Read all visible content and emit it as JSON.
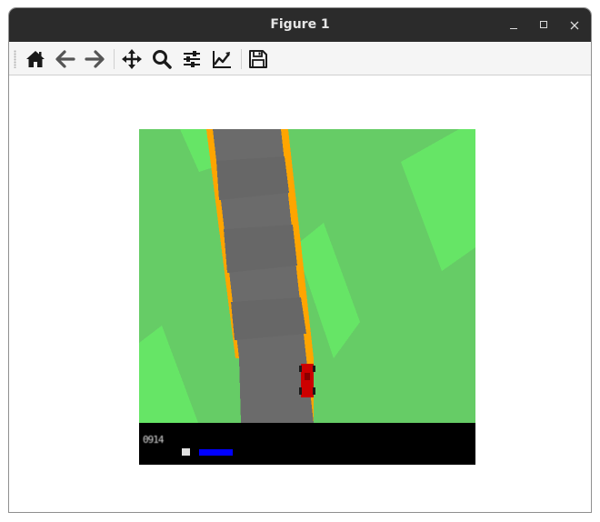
{
  "window": {
    "title": "Figure 1"
  },
  "toolbar": {
    "tools": [
      {
        "name": "home",
        "icon": "home-icon"
      },
      {
        "name": "back",
        "icon": "arrow-left-icon"
      },
      {
        "name": "forward",
        "icon": "arrow-right-icon"
      },
      {
        "name": "pan",
        "icon": "move-icon"
      },
      {
        "name": "zoom",
        "icon": "magnifier-icon"
      },
      {
        "name": "configure-subplots",
        "icon": "sliders-icon"
      },
      {
        "name": "edit-axes",
        "icon": "line-chart-icon"
      },
      {
        "name": "save",
        "icon": "floppy-disk-icon"
      }
    ]
  },
  "game": {
    "score_text": "0914",
    "colors": {
      "grass": "#66cc66",
      "grass_light": "#66e566",
      "road": "#6b6b6b",
      "road_edge": "#ffa500",
      "car": "#cc0000",
      "hud": "#000000",
      "speed_bar": "#0000ff"
    }
  }
}
